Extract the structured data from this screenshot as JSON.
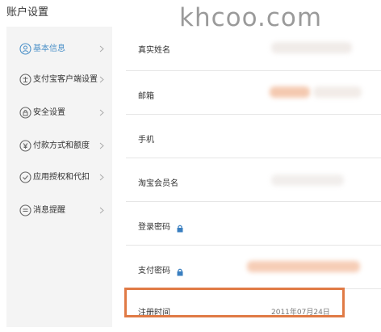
{
  "header": {
    "title": "账户设置",
    "watermark": "khcoo.com"
  },
  "sidebar": {
    "items": [
      {
        "label": "基本信息",
        "icon": "user-icon",
        "active": true
      },
      {
        "label": "支付宝客户端设置",
        "icon": "client-icon",
        "active": false
      },
      {
        "label": "安全设置",
        "icon": "lock-icon",
        "active": false
      },
      {
        "label": "付款方式和额度",
        "icon": "yuan-icon",
        "active": false
      },
      {
        "label": "应用授权和代扣",
        "icon": "check-circle-icon",
        "active": false
      },
      {
        "label": "消息提醒",
        "icon": "message-icon",
        "active": false
      }
    ]
  },
  "rows": [
    {
      "label": "真实姓名"
    },
    {
      "label": "邮箱"
    },
    {
      "label": "手机"
    },
    {
      "label": "淘宝会员名"
    },
    {
      "label": "登录密码",
      "lock": true
    },
    {
      "label": "支付密码",
      "lock": true
    },
    {
      "label": "注册时间",
      "value": "2011年07月24日"
    }
  ],
  "colors": {
    "accent": "#4a90c8",
    "highlight": "#e07a45",
    "sidebar_bg": "#f4f4f4"
  }
}
